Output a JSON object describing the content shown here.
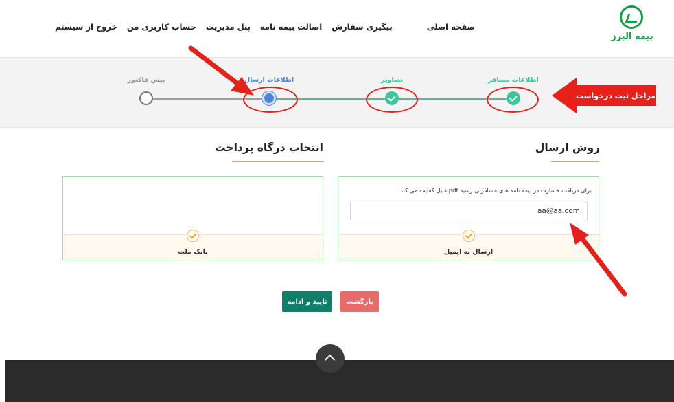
{
  "header": {
    "nav": {
      "home": "صفحه اصلی",
      "order_tracking": "پیگیری سفارش",
      "policy_authenticity": "اصالت بیمه نامه",
      "admin_panel": "پنل مدیریت",
      "my_account": "حساب کاربری من",
      "logout": "خروج از سیستم"
    },
    "logo_text": "بیمه البرز",
    "logo_icon": "alborz-logo-icon"
  },
  "stepper": {
    "steps": [
      {
        "label": "اطلاعات مسافر",
        "status": "done",
        "color": "#3cc69b"
      },
      {
        "label": "تصاویر",
        "status": "done",
        "color": "#3cc69b"
      },
      {
        "label": "اطلاعات ارسال",
        "status": "current",
        "color": "#4f86d8"
      },
      {
        "label": "پیش فاکتور",
        "status": "todo",
        "color": "#999999"
      }
    ],
    "annotation_label": "مراحل ثبت درخواست"
  },
  "delivery": {
    "title": "روش ارسال",
    "description": "برای دریافت خسارت در بیمه نامه های مسافرتی رسید pdf فایل کفایت می کند",
    "email_value": "aa@aa.com",
    "option_label": "ارسال به ایمیل"
  },
  "payment": {
    "title": "انتخاب درگاه پرداخت",
    "option_label": "بانک ملت"
  },
  "actions": {
    "confirm_label": "تایید و ادامه",
    "back_label": "بازگشت"
  },
  "colors": {
    "brand_green": "#179e4a",
    "accent_teal": "#127e6a",
    "progress_green": "#3cc69b",
    "current_blue": "#4f86d8",
    "annotation_red": "#e8201a"
  }
}
